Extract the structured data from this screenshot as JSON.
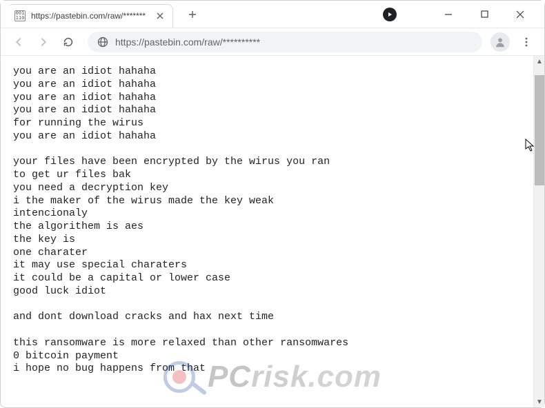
{
  "tab": {
    "favicon_label": "001\n110",
    "title": "https://pastebin.com/raw/*******"
  },
  "toolbar": {
    "url": "https://pastebin.com/raw/**********"
  },
  "page_text": "you are an idiot hahaha\nyou are an idiot hahaha\nyou are an idiot hahaha\nyou are an idiot hahaha\nfor running the wirus\nyou are an idiot hahaha\n\nyour files have been encrypted by the wirus you ran\nto get ur files bak\nyou need a decryption key\ni the maker of the wirus made the key weak\nintencionaly\nthe algorithem is aes\nthe key is\none charater\nit may use special charaters\nit could be a capital or lower case\ngood luck idiot\n\nand dont download cracks and hax next time\n\nthis ransomware is more relaxed than other ransomwares\n0 bitcoin payment\ni hope no bug happens from that",
  "watermark": {
    "pc": "PC",
    "risk": "risk",
    "com": ".com"
  }
}
